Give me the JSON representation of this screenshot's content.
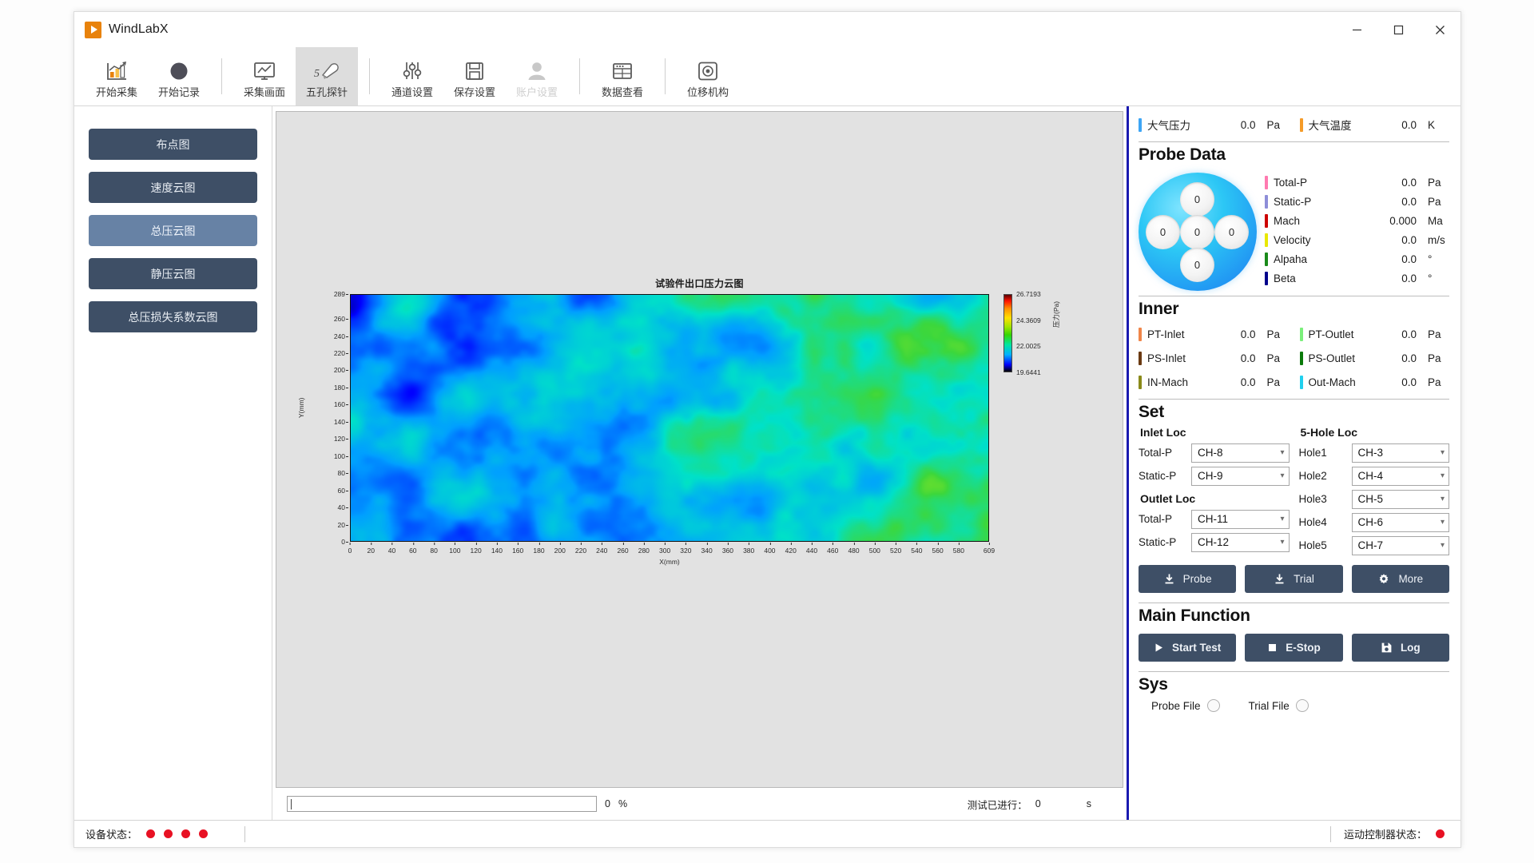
{
  "window": {
    "app_title": "WindLabX",
    "minimize": "─",
    "maximize": "☐",
    "close": "✕"
  },
  "ribbon": {
    "items": [
      {
        "label": "开始采集",
        "icon": "bar-chart-icon",
        "state": "normal"
      },
      {
        "label": "开始记录",
        "icon": "record-circle-icon",
        "state": "normal"
      },
      {
        "label": "采集画面",
        "icon": "monitor-chart-icon",
        "state": "normal"
      },
      {
        "label": "五孔探针",
        "icon": "five-hole-probe-icon",
        "state": "active"
      },
      {
        "label": "通道设置",
        "icon": "sliders-icon",
        "state": "normal"
      },
      {
        "label": "保存设置",
        "icon": "save-disk-icon",
        "state": "normal"
      },
      {
        "label": "账户设置",
        "icon": "user-icon",
        "state": "disabled"
      },
      {
        "label": "数据查看",
        "icon": "database-view-icon",
        "state": "normal"
      },
      {
        "label": "位移机构",
        "icon": "target-icon",
        "state": "normal"
      }
    ]
  },
  "leftnav": {
    "items": [
      {
        "label": "布点图",
        "selected": false
      },
      {
        "label": "速度云图",
        "selected": false
      },
      {
        "label": "总压云图",
        "selected": true
      },
      {
        "label": "静压云图",
        "selected": false
      },
      {
        "label": "总压损失系数云图",
        "selected": false
      }
    ]
  },
  "chart_data": {
    "type": "heatmap",
    "title": "试验件出口压力云图",
    "xlabel": "X(mm)",
    "ylabel": "Y(mm)",
    "xlim": [
      0,
      609
    ],
    "ylim": [
      0,
      289
    ],
    "xticks": [
      0,
      20,
      40,
      60,
      80,
      100,
      120,
      140,
      160,
      180,
      200,
      220,
      240,
      260,
      280,
      300,
      320,
      340,
      360,
      380,
      400,
      420,
      440,
      460,
      480,
      500,
      520,
      540,
      560,
      580,
      609
    ],
    "yticks": [
      0,
      20,
      40,
      60,
      80,
      100,
      120,
      140,
      160,
      180,
      200,
      220,
      240,
      260,
      289
    ],
    "colorbar": {
      "label": "压力(Pa)",
      "ticks": [
        19.6441,
        22.0025,
        24.3609,
        26.7193
      ],
      "vmin": 19.6441,
      "vmax": 26.7193
    },
    "grid": false,
    "legend": "colorbar-right"
  },
  "progress": {
    "value": "0",
    "unit": "%",
    "elapsed_label": "测试已进行：",
    "elapsed_value": "0",
    "elapsed_unit": "s"
  },
  "right": {
    "atmosphere": [
      {
        "name": "大气压力",
        "value": "0.0",
        "unit": "Pa",
        "color": "#3da5f5"
      },
      {
        "name": "大气温度",
        "value": "0.0",
        "unit": "K",
        "color": "#f59b28"
      }
    ],
    "probe": {
      "heading": "Probe Data",
      "holes": [
        "0",
        "0",
        "0",
        "0",
        "0"
      ],
      "values": [
        {
          "name": "Total-P",
          "value": "0.0",
          "unit": "Pa",
          "color": "#ff7ab0"
        },
        {
          "name": "Static-P",
          "value": "0.0",
          "unit": "Pa",
          "color": "#8e8ed8"
        },
        {
          "name": "Mach",
          "value": "0.000",
          "unit": "Ma",
          "color": "#cc0000"
        },
        {
          "name": "Velocity",
          "value": "0.0",
          "unit": "m/s",
          "color": "#e8e800"
        },
        {
          "name": "Alpaha",
          "value": "0.0",
          "unit": "°",
          "color": "#1a8a1a"
        },
        {
          "name": "Beta",
          "value": "0.0",
          "unit": "°",
          "color": "#00008b"
        }
      ]
    },
    "inner": {
      "heading": "Inner",
      "left": [
        {
          "name": "PT-Inlet",
          "value": "0.0",
          "unit": "Pa",
          "color": "#f0864a"
        },
        {
          "name": "PS-Inlet",
          "value": "0.0",
          "unit": "Pa",
          "color": "#6b3a12"
        },
        {
          "name": "IN-Mach",
          "value": "0.0",
          "unit": "Pa",
          "color": "#8a8a1a"
        }
      ],
      "right": [
        {
          "name": "PT-Outlet",
          "value": "0.0",
          "unit": "Pa",
          "color": "#7bef7b"
        },
        {
          "name": "PS-Outlet",
          "value": "0.0",
          "unit": "Pa",
          "color": "#0a7a0a"
        },
        {
          "name": "Out-Mach",
          "value": "0.0",
          "unit": "Pa",
          "color": "#20d0ee"
        }
      ]
    },
    "set": {
      "heading": "Set",
      "inlet_title": "Inlet Loc",
      "outlet_title": "Outlet Loc",
      "hole_title": "5-Hole Loc",
      "inlet": [
        {
          "label": "Total-P",
          "value": "CH-8"
        },
        {
          "label": "Static-P",
          "value": "CH-9"
        }
      ],
      "outlet": [
        {
          "label": "Total-P",
          "value": "CH-11"
        },
        {
          "label": "Static-P",
          "value": "CH-12"
        }
      ],
      "holes": [
        {
          "label": "Hole1",
          "value": "CH-3"
        },
        {
          "label": "Hole2",
          "value": "CH-4"
        },
        {
          "label": "Hole3",
          "value": "CH-5"
        },
        {
          "label": "Hole4",
          "value": "CH-6"
        },
        {
          "label": "Hole5",
          "value": "CH-7"
        }
      ],
      "buttons": [
        {
          "label": "Probe",
          "icon": "download-icon"
        },
        {
          "label": "Trial",
          "icon": "download-icon"
        },
        {
          "label": "More",
          "icon": "gear-icon"
        }
      ]
    },
    "main_function": {
      "heading": "Main Function",
      "buttons": [
        {
          "label": "Start Test",
          "icon": "play-icon"
        },
        {
          "label": "E-Stop",
          "icon": "stop-square-icon"
        },
        {
          "label": "Log",
          "icon": "save-disk-icon"
        }
      ]
    },
    "sys": {
      "heading": "Sys",
      "items": [
        {
          "label": "Probe File"
        },
        {
          "label": "Trial File"
        }
      ]
    }
  },
  "statusbar": {
    "device_label": "设备状态：",
    "device_leds": [
      "#e81123",
      "#e81123",
      "#e81123",
      "#e81123"
    ],
    "motion_label": "运动控制器状态：",
    "motion_led": "#e81123"
  }
}
